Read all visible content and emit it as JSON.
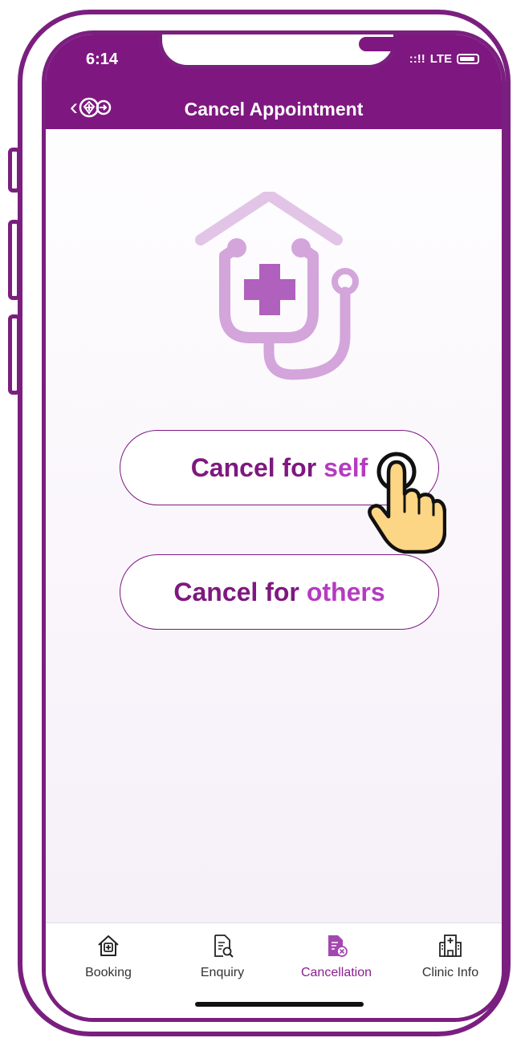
{
  "status_bar": {
    "time": "6:14",
    "signal": "::!!",
    "network": "LTE"
  },
  "header": {
    "title": "Cancel Appointment"
  },
  "actions": {
    "self": {
      "prefix": "Cancel for",
      "accent": "self"
    },
    "others": {
      "prefix": "Cancel for",
      "accent": "others"
    }
  },
  "tabs": [
    {
      "label": "Booking",
      "icon": "house-plus-icon",
      "active": false
    },
    {
      "label": "Enquiry",
      "icon": "document-search-icon",
      "active": false
    },
    {
      "label": "Cancellation",
      "icon": "document-cancel-icon",
      "active": true
    },
    {
      "label": "Clinic Info",
      "icon": "hospital-icon",
      "active": false
    }
  ],
  "colors": {
    "brand": "#7e1880",
    "accent": "#b43cc0",
    "illustration": "#d3a5db"
  }
}
